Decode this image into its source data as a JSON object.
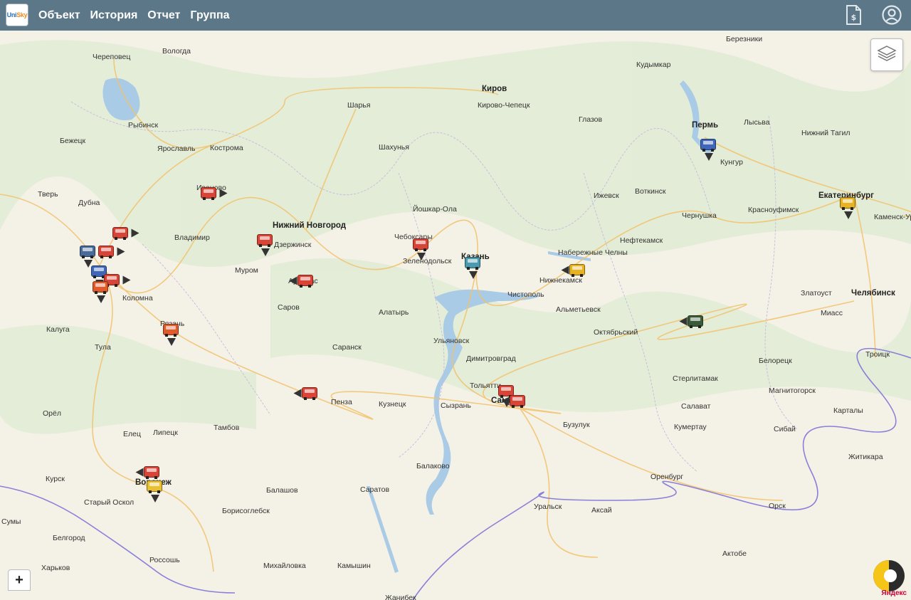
{
  "app": {
    "logo_text_a": "Uni",
    "logo_text_b": "Sky"
  },
  "nav": {
    "items": [
      {
        "label": "Объект"
      },
      {
        "label": "История"
      },
      {
        "label": "Отчет"
      },
      {
        "label": "Группа"
      }
    ]
  },
  "header_icons": {
    "billing": "invoice-dollar-icon",
    "account": "user-account-icon"
  },
  "map": {
    "layers_icon": "layers-icon",
    "zoom_in_label": "+",
    "attribution": "Яндекс",
    "colors": {
      "land": "#f4f1e6",
      "forest": "#e2ecd5",
      "water": "#a9cbe6",
      "roads": "#f2c26b",
      "borders": "#8a7fd9",
      "topbar": "#5c7787"
    },
    "cities": [
      {
        "name": "Череповец",
        "big": false
      },
      {
        "name": "Вологда",
        "big": false
      },
      {
        "name": "Рыбинск",
        "big": false
      },
      {
        "name": "Бежецк",
        "big": false
      },
      {
        "name": "Ярославль",
        "big": false
      },
      {
        "name": "Кострома",
        "big": false
      },
      {
        "name": "Тверь",
        "big": false
      },
      {
        "name": "Дубна",
        "big": false
      },
      {
        "name": "Иваново",
        "big": false
      },
      {
        "name": "Владимир",
        "big": false
      },
      {
        "name": "Нижний Новгород",
        "big": true
      },
      {
        "name": "Дзержинск",
        "big": false
      },
      {
        "name": "Муром",
        "big": false
      },
      {
        "name": "Арзамас",
        "big": false
      },
      {
        "name": "Саров",
        "big": false
      },
      {
        "name": "Коломна",
        "big": false
      },
      {
        "name": "Рязань",
        "big": false
      },
      {
        "name": "Калуга",
        "big": false
      },
      {
        "name": "Тула",
        "big": false
      },
      {
        "name": "Орёл",
        "big": false
      },
      {
        "name": "Елец",
        "big": false
      },
      {
        "name": "Липецк",
        "big": false
      },
      {
        "name": "Тамбов",
        "big": false
      },
      {
        "name": "Курск",
        "big": false
      },
      {
        "name": "Воронеж",
        "big": true
      },
      {
        "name": "Старый Оскол",
        "big": false
      },
      {
        "name": "Белгород",
        "big": false
      },
      {
        "name": "Сумы",
        "big": false
      },
      {
        "name": "Харьков",
        "big": false
      },
      {
        "name": "Россошь",
        "big": false
      },
      {
        "name": "Балашов",
        "big": false
      },
      {
        "name": "Борисоглебск",
        "big": false
      },
      {
        "name": "Михайловка",
        "big": false
      },
      {
        "name": "Камышин",
        "big": false
      },
      {
        "name": "Саратов",
        "big": false
      },
      {
        "name": "Пенза",
        "big": false
      },
      {
        "name": "Кузнецк",
        "big": false
      },
      {
        "name": "Саранск",
        "big": false
      },
      {
        "name": "Алатырь",
        "big": false
      },
      {
        "name": "Шарья",
        "big": false
      },
      {
        "name": "Шахунья",
        "big": false
      },
      {
        "name": "Киров",
        "big": true
      },
      {
        "name": "Кирово-Чепецк",
        "big": false
      },
      {
        "name": "Йошкар-Ола",
        "big": false
      },
      {
        "name": "Чебоксары",
        "big": false
      },
      {
        "name": "Зеленодольск",
        "big": false
      },
      {
        "name": "Казань",
        "big": true
      },
      {
        "name": "Чистополь",
        "big": false
      },
      {
        "name": "Ульяновск",
        "big": false
      },
      {
        "name": "Димитровград",
        "big": false
      },
      {
        "name": "Тольятти",
        "big": false
      },
      {
        "name": "Самара",
        "big": true
      },
      {
        "name": "Сызрань",
        "big": false
      },
      {
        "name": "Балаково",
        "big": false
      },
      {
        "name": "Глазов",
        "big": false
      },
      {
        "name": "Ижевск",
        "big": false
      },
      {
        "name": "Воткинск",
        "big": false
      },
      {
        "name": "Набережные Челны",
        "big": false
      },
      {
        "name": "Нижнекамск",
        "big": false
      },
      {
        "name": "Альметьевск",
        "big": false
      },
      {
        "name": "Нефтекамск",
        "big": false
      },
      {
        "name": "Октябрьский",
        "big": false
      },
      {
        "name": "Бузулук",
        "big": false
      },
      {
        "name": "Уральск",
        "big": false
      },
      {
        "name": "Аксай",
        "big": false
      },
      {
        "name": "Оренбург",
        "big": false
      },
      {
        "name": "Орск",
        "big": false
      },
      {
        "name": "Актобе",
        "big": false
      },
      {
        "name": "Кудымкар",
        "big": false
      },
      {
        "name": "Березники",
        "big": false
      },
      {
        "name": "Пермь",
        "big": true
      },
      {
        "name": "Кунгур",
        "big": false
      },
      {
        "name": "Лысьва",
        "big": false
      },
      {
        "name": "Нижний Тагил",
        "big": false
      },
      {
        "name": "Чернушка",
        "big": false
      },
      {
        "name": "Красноуфимск",
        "big": false
      },
      {
        "name": "Екатеринбург",
        "big": true
      },
      {
        "name": "Каменск-Уральский",
        "big": false
      },
      {
        "name": "Златоуст",
        "big": false
      },
      {
        "name": "Челябинск",
        "big": true
      },
      {
        "name": "Миасс",
        "big": false
      },
      {
        "name": "Стерлитамак",
        "big": false
      },
      {
        "name": "Белорецк",
        "big": false
      },
      {
        "name": "Салават",
        "big": false
      },
      {
        "name": "Кумертау",
        "big": false
      },
      {
        "name": "Магнитогорск",
        "big": false
      },
      {
        "name": "Сибай",
        "big": false
      },
      {
        "name": "Карталы",
        "big": false
      },
      {
        "name": "Троицк",
        "big": false
      },
      {
        "name": "Житикара",
        "big": false
      },
      {
        "name": "Жанибек",
        "big": false
      }
    ],
    "vehicles": [
      {
        "color": "#d94436",
        "heading": "east"
      },
      {
        "color": "#d94436",
        "heading": "south"
      },
      {
        "color": "#d94436",
        "heading": "west"
      },
      {
        "color": "#e05a2a",
        "heading": "south"
      },
      {
        "color": "#d94436",
        "heading": "west"
      },
      {
        "color": "#d94436",
        "heading": "east"
      },
      {
        "color": "#d94436",
        "heading": "east"
      },
      {
        "color": "#4a6a9a",
        "heading": "south"
      },
      {
        "color": "#3f66b8",
        "heading": "south"
      },
      {
        "color": "#e8b321",
        "heading": "west"
      },
      {
        "color": "#3a5a3a",
        "heading": "west"
      },
      {
        "color": "#e8b321",
        "heading": "south"
      },
      {
        "color": "#d94436",
        "heading": "south"
      },
      {
        "color": "#4a9ab0",
        "heading": "south"
      },
      {
        "color": "#d94436",
        "heading": "south"
      },
      {
        "color": "#e8c030",
        "heading": "south"
      },
      {
        "color": "#d94436",
        "heading": "west"
      },
      {
        "color": "#3f66b8",
        "heading": "south"
      },
      {
        "color": "#d94436",
        "heading": "east"
      },
      {
        "color": "#d94436",
        "heading": "west"
      },
      {
        "color": "#e05a2a",
        "heading": "south"
      }
    ]
  }
}
